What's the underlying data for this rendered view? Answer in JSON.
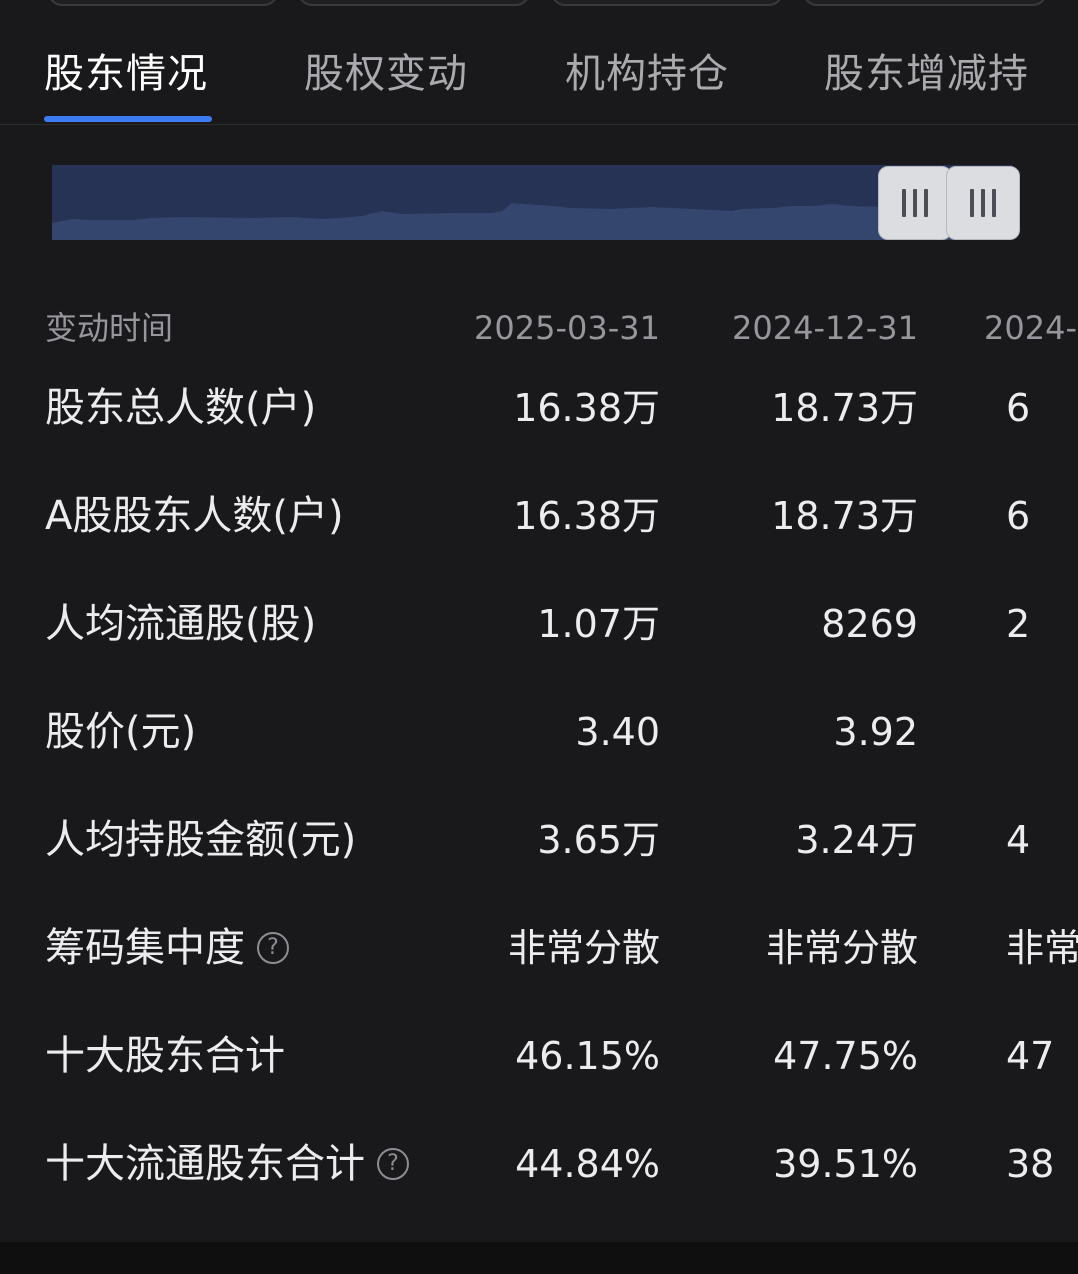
{
  "tabs": [
    {
      "label": "股东情况",
      "active": true
    },
    {
      "label": "股权变动",
      "active": false
    },
    {
      "label": "机构持仓",
      "active": false
    },
    {
      "label": "股东增减持",
      "active": false
    }
  ],
  "colors": {
    "background": "#19191b",
    "accent": "#3d7bf2",
    "slider_track": "#273355",
    "slider_area": "#34456e"
  },
  "range_slider": {
    "handle_icon": "grip-icon"
  },
  "table": {
    "header_label": "变动时间",
    "columns": [
      "2025-03-31",
      "2024-12-31",
      "2024-"
    ],
    "rows": [
      {
        "label": "股东总人数(户)",
        "values": [
          "16.38万",
          "18.73万",
          "6"
        ],
        "help": false
      },
      {
        "label": "A股股东人数(户)",
        "values": [
          "16.38万",
          "18.73万",
          "6"
        ],
        "help": false
      },
      {
        "label": "人均流通股(股)",
        "values": [
          "1.07万",
          "8269",
          "2"
        ],
        "help": false
      },
      {
        "label": "股价(元)",
        "values": [
          "3.40",
          "3.92",
          ""
        ],
        "help": false
      },
      {
        "label": "人均持股金额(元)",
        "values": [
          "3.65万",
          "3.24万",
          "4"
        ],
        "help": false
      },
      {
        "label": "筹码集中度",
        "values": [
          "非常分散",
          "非常分散",
          "非常"
        ],
        "help": true
      },
      {
        "label": "十大股东合计",
        "values": [
          "46.15%",
          "47.75%",
          "47"
        ],
        "help": false
      },
      {
        "label": "十大流通股东合计",
        "values": [
          "44.84%",
          "39.51%",
          "38"
        ],
        "help": true
      }
    ]
  },
  "help_icon_glyph": "?"
}
